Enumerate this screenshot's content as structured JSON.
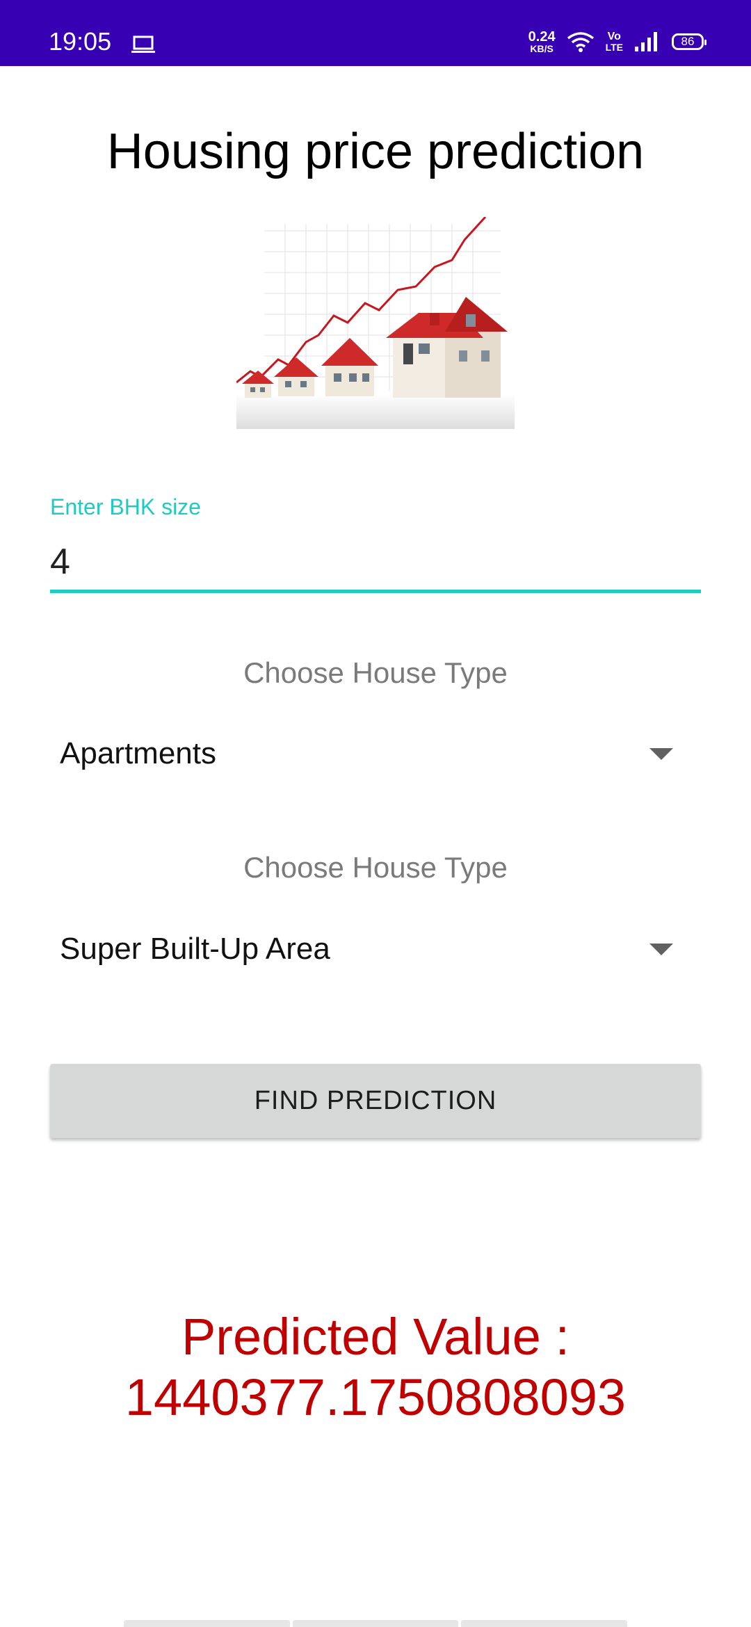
{
  "status_bar": {
    "time": "19:05",
    "net_speed_value": "0.24",
    "net_speed_unit": "KB/S",
    "volte_top": "Vo",
    "volte_bottom": "LTE",
    "battery": "86",
    "background": "#3700b3"
  },
  "title": "Housing price prediction",
  "bhk_field": {
    "label": "Enter BHK size",
    "value": "4",
    "accent": "#1ecbc1"
  },
  "house_type_section": {
    "label": "Choose House Type",
    "selected": "Apartments"
  },
  "area_type_section": {
    "label": "Choose House Type",
    "selected": "Super Built-Up Area"
  },
  "predict_button": {
    "label": "FIND PREDICTION"
  },
  "result": {
    "line1": "Predicted Value :",
    "line2": "1440377.1750808093",
    "color": "#c00000"
  },
  "icons": {
    "laptop": "laptop-icon",
    "wifi": "wifi-icon",
    "signal": "signal-icon",
    "dropdown": "dropdown-arrow-icon"
  }
}
